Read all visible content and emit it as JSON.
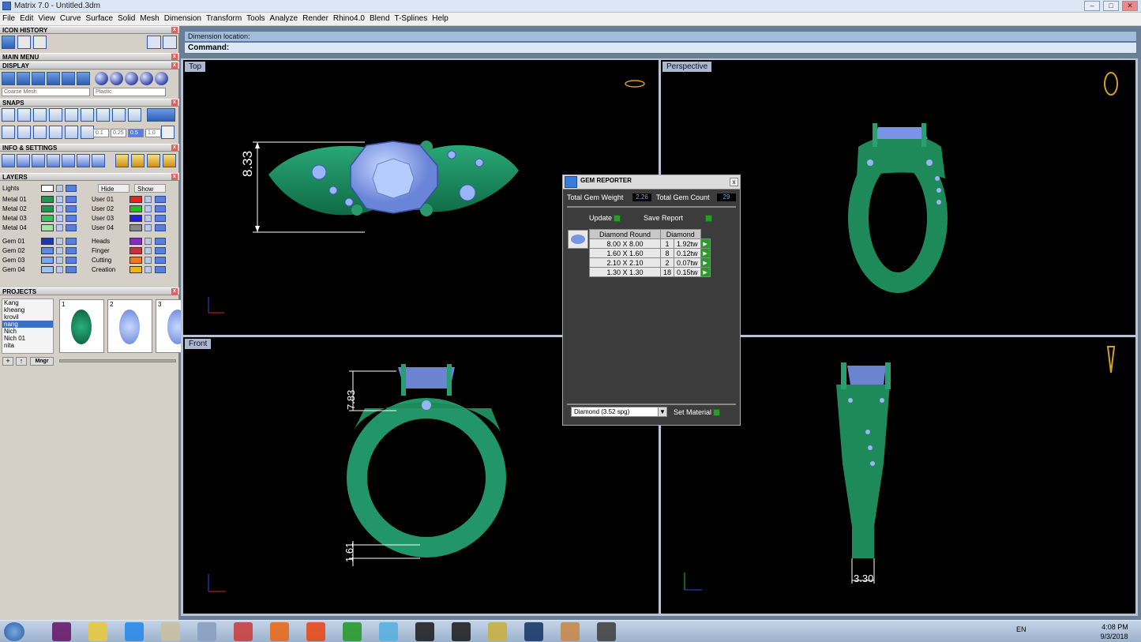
{
  "window": {
    "title": "Matrix 7.0 - Untitled.3dm"
  },
  "menu": [
    "File",
    "Edit",
    "View",
    "Curve",
    "Surface",
    "Solid",
    "Mesh",
    "Dimension",
    "Transform",
    "Tools",
    "Analyze",
    "Render",
    "Rhino4.0",
    "Blend",
    "T-Splines",
    "Help"
  ],
  "left": {
    "icon_history": "ICON HISTORY",
    "main_menu": "MAIN MENU",
    "display": "DISPLAY",
    "display_mesh": "Coarse Mesh",
    "display_material": "Plastic",
    "snaps": "SNAPS",
    "snap_values": [
      "0.1",
      "0.25",
      "0.5",
      "1.0"
    ],
    "info_settings": "INFO & SETTINGS",
    "layers": "LAYERS",
    "lights": "Lights",
    "hide": "Hide",
    "show": "Show",
    "layer_left": [
      "Metal 01",
      "Metal 02",
      "Metal 03",
      "Metal 04",
      "Gem 01",
      "Gem 02",
      "Gem 03",
      "Gem 04"
    ],
    "layer_right": [
      "User 01",
      "User 02",
      "User 03",
      "User 04",
      "Heads",
      "Finger",
      "Cutting",
      "Creation"
    ],
    "layer_colors_left": [
      "#1a9a50",
      "#1a9a50",
      "#3ac05a",
      "#9ce8a0",
      "#1a3aa8",
      "#5a8ae8",
      "#7aa8f0",
      "#9ac4f8"
    ],
    "layer_colors_right": [
      "#e82020",
      "#20c020",
      "#2020e0",
      "#888888",
      "#8a2ab8",
      "#c83040",
      "#f07820",
      "#f0b020"
    ],
    "projects": "PROJECTS",
    "project_list": [
      "Kang",
      "kheang",
      "krovil",
      "nang",
      "Nich",
      "Nich 01",
      "nita"
    ],
    "project_thumbs": [
      "1",
      "2",
      "3"
    ],
    "mngr": "Mngr"
  },
  "command": {
    "line1": "Dimension location:",
    "line2": "Command:"
  },
  "viewports": {
    "top": "Top",
    "perspective": "Perspective",
    "front": "Front"
  },
  "dims": {
    "top_height": "8.33",
    "front_top": "7.83",
    "front_bottom": "1.61",
    "right_width": "3.30"
  },
  "gem_reporter": {
    "title": "GEM REPORTER",
    "total_weight_label": "Total Gem Weight",
    "total_weight": "2.26",
    "total_count_label": "Total Gem Count",
    "total_count": "29",
    "update": "Update",
    "save_report": "Save Report",
    "col_size": "Diamond Round",
    "col_material": "Diamond",
    "rows": [
      [
        "8.00 X 8.00",
        "1",
        "1.92tw"
      ],
      [
        "1.60 X 1.60",
        "8",
        "0.12tw"
      ],
      [
        "2.10 X 2.10",
        "2",
        "0.07tw"
      ],
      [
        "1.30 X 1.30",
        "18",
        "0.15tw"
      ]
    ],
    "material_select": "Diamond    (3.52 spg)",
    "set_material": "Set Material"
  },
  "taskbar": {
    "lang": "EN",
    "time": "4:08 PM",
    "date": "9/3/2018"
  },
  "colors": {
    "ring": "#1e8a5a",
    "gem": "#8aa8f0",
    "accent": "#2e5fb5"
  }
}
